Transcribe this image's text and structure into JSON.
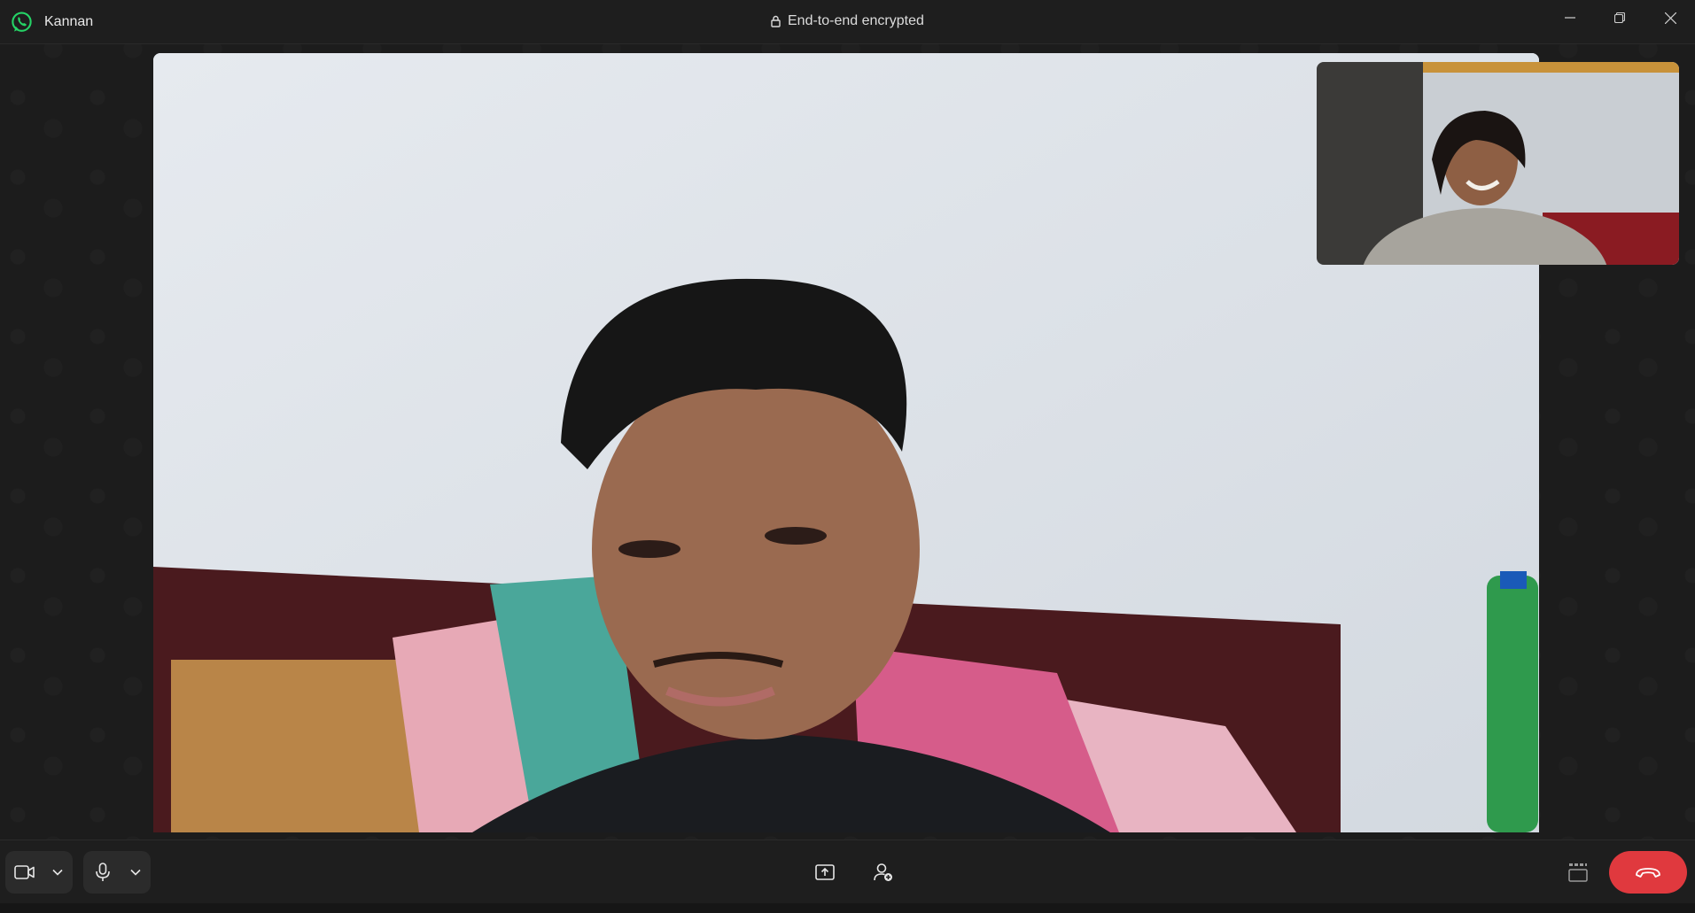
{
  "window": {
    "contact_name": "Kannan",
    "encryption_label": "End-to-end encrypted"
  },
  "icons": {
    "app_logo": "whatsapp-logo-icon",
    "lock": "lock-icon",
    "minimize": "minimize-icon",
    "maximize": "restore-icon",
    "close": "close-icon",
    "camera": "video-camera-icon",
    "mic": "microphone-icon",
    "share": "screen-share-icon",
    "add_person": "add-participant-icon",
    "layout": "layout-grid-icon",
    "end_call": "end-call-icon"
  },
  "colors": {
    "brand": "#25d366",
    "end_call": "#e0393e",
    "background": "#1c1c1c"
  }
}
